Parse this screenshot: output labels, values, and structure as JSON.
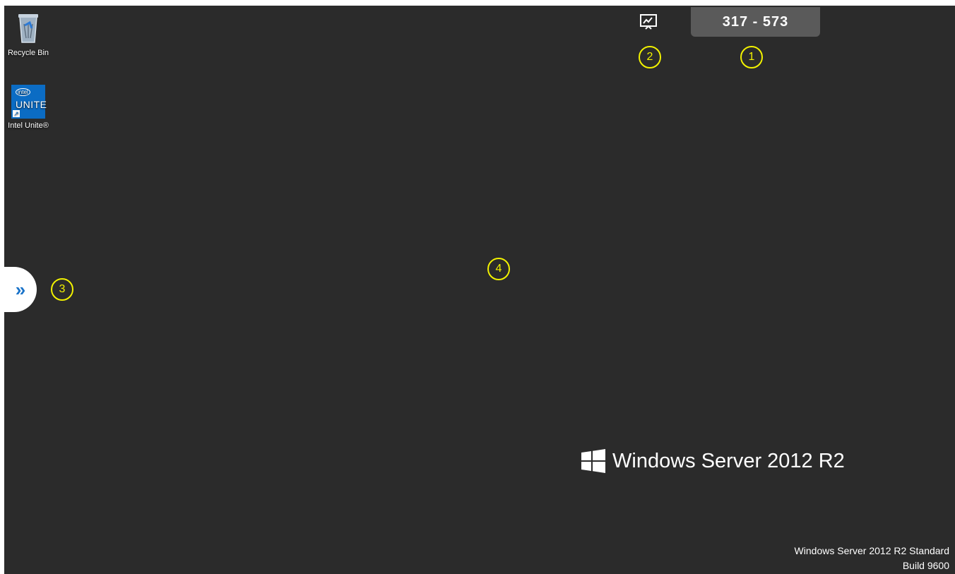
{
  "desktop": {
    "icons": [
      {
        "label": "Recycle Bin",
        "icon": "recycle-bin-icon"
      },
      {
        "label": "Intel Unite®",
        "icon": "intel-unite-icon"
      }
    ],
    "unite_logo": {
      "intel": "intel",
      "word": "UNITE"
    }
  },
  "top_bar": {
    "connection_code": "317 - 573",
    "share_icon": "presentation-screen-icon"
  },
  "side_tab": {
    "label": "»",
    "icon": "double-chevron-right-icon"
  },
  "markers": [
    "1",
    "2",
    "3",
    "4"
  ],
  "branding": {
    "title": "Windows Server 2012 R2",
    "edition_line": "Windows Server 2012 R2 Standard",
    "build_line": "Build 9600"
  },
  "colors": {
    "background": "#2b2b2b",
    "marker": "#f2f200",
    "unite_blue": "#0b6cc4",
    "tab_chevron": "#1a73c9"
  }
}
